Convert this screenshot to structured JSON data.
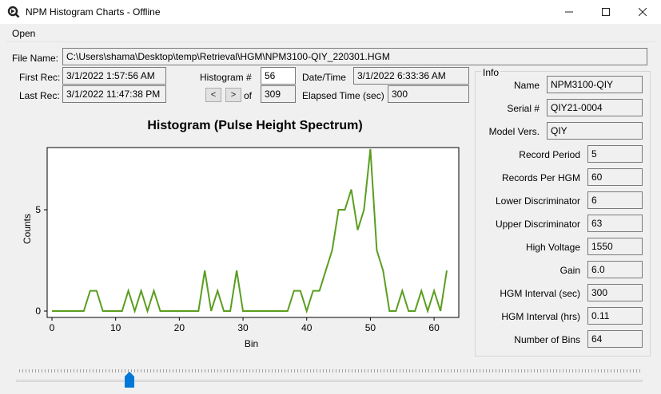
{
  "window": {
    "title": "NPM Histogram Charts - Offline"
  },
  "menu": {
    "open": "Open"
  },
  "file": {
    "label": "File Name:",
    "value": "C:\\Users\\shama\\Desktop\\temp\\Retrieval\\HGM\\NPM3100-QIY_220301.HGM"
  },
  "records": {
    "first_label": "First Rec:",
    "first_value": "3/1/2022 1:57:56 AM",
    "last_label": "Last Rec:",
    "last_value": "3/1/2022 11:47:38 PM"
  },
  "histogram": {
    "label": "Histogram #",
    "value": "56",
    "prev": "<",
    "next": ">",
    "of_label": "of",
    "total": "309"
  },
  "datetime": {
    "label": "Date/Time",
    "value": "3/1/2022 6:33:36 AM",
    "elapsed_label": "Elapsed Time (sec)",
    "elapsed_value": "300"
  },
  "info": {
    "legend": "Info",
    "name_label": "Name",
    "name_value": "NPM3100-QIY",
    "serial_label": "Serial #",
    "serial_value": "QIY21-0004",
    "model_label": "Model Vers.",
    "model_value": "QIY",
    "record_period_label": "Record Period",
    "record_period_value": "5",
    "records_per_hgm_label": "Records Per HGM",
    "records_per_hgm_value": "60",
    "lower_disc_label": "Lower Discriminator",
    "lower_disc_value": "6",
    "upper_disc_label": "Upper Discriminator",
    "upper_disc_value": "63",
    "high_voltage_label": "High Voltage",
    "high_voltage_value": "1550",
    "gain_label": "Gain",
    "gain_value": "6.0",
    "hgm_interval_sec_label": "HGM Interval (sec)",
    "hgm_interval_sec_value": "300",
    "hgm_interval_hrs_label": "HGM Interval (hrs)",
    "hgm_interval_hrs_value": "0.11",
    "num_bins_label": "Number of Bins",
    "num_bins_value": "64"
  },
  "slider": {
    "value": 56,
    "max": 309
  },
  "colors": {
    "series": "#5a9e1f",
    "thumb": "#0078d7"
  },
  "chart_data": {
    "type": "line",
    "title": "Histogram (Pulse Height Spectrum)",
    "xlabel": "Bin",
    "ylabel": "Counts",
    "xlim": [
      0,
      63
    ],
    "ylim": [
      0,
      8.5
    ],
    "xticks": [
      0,
      10,
      20,
      30,
      40,
      50,
      60
    ],
    "yticks": [
      0,
      5
    ],
    "grid": false,
    "x": [
      0,
      1,
      2,
      3,
      4,
      5,
      6,
      7,
      8,
      9,
      10,
      11,
      12,
      13,
      14,
      15,
      16,
      17,
      18,
      19,
      20,
      21,
      22,
      23,
      24,
      25,
      26,
      27,
      28,
      29,
      30,
      31,
      32,
      33,
      34,
      35,
      36,
      37,
      38,
      39,
      40,
      41,
      42,
      43,
      44,
      45,
      46,
      47,
      48,
      49,
      50,
      51,
      52,
      53,
      54,
      55,
      56,
      57,
      58,
      59,
      60,
      61,
      62,
      63
    ],
    "series": [
      {
        "values": [
          0,
          0,
          0,
          0,
          0,
          0,
          1,
          1,
          0,
          0,
          0,
          0,
          1,
          0,
          1,
          0,
          1,
          0,
          0,
          0,
          0,
          0,
          0,
          0,
          2,
          0,
          1,
          0,
          0,
          2,
          0,
          0,
          0,
          0,
          0,
          0,
          0,
          0,
          1,
          1,
          0,
          1,
          1,
          2,
          3,
          5,
          5,
          6,
          4,
          5,
          8,
          3,
          2,
          0,
          0,
          1,
          0,
          0,
          1,
          0,
          1,
          0,
          2
        ]
      }
    ]
  }
}
